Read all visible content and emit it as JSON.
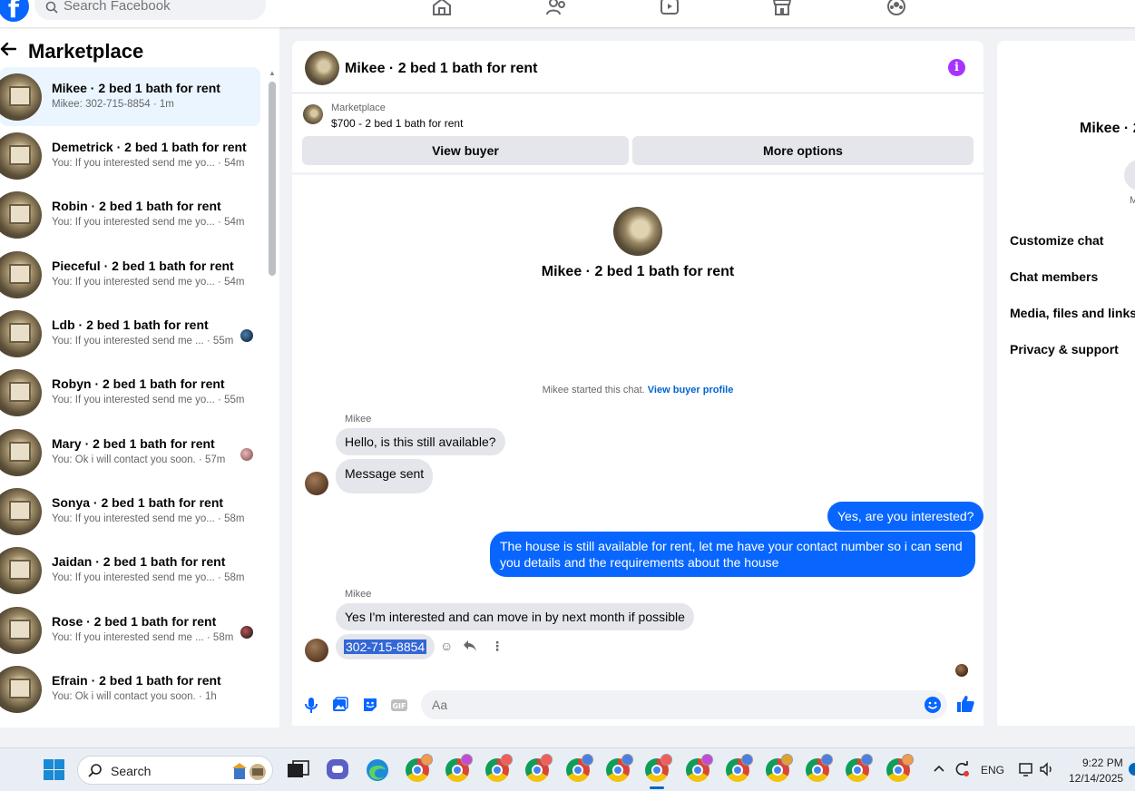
{
  "topbar": {
    "logo_letter": "f",
    "search_placeholder": "Search Facebook",
    "nav_icons": [
      "home-icon",
      "friends-icon",
      "video-icon",
      "marketplace-store-icon",
      "groups-icon"
    ]
  },
  "sidebar": {
    "title": "Marketplace",
    "conversations": [
      {
        "name": "Mikee · 2 bed 1 bath for rent",
        "preview": "Mikee: 302-715-8854 · 1m",
        "active": true
      },
      {
        "name": "Demetrick · 2 bed 1 bath for rent",
        "preview": "You: If you interested send me yo... · 54m"
      },
      {
        "name": "Robin · 2 bed 1 bath for rent",
        "preview": "You: If you interested send me yo... · 54m"
      },
      {
        "name": "Pieceful · 2 bed 1 bath for rent",
        "preview": "You: If you interested send me yo... · 54m"
      },
      {
        "name": "Ldb · 2 bed 1 bath for rent",
        "preview": "You: If you interested send me ... · 55m"
      },
      {
        "name": "Robyn · 2 bed 1 bath for rent",
        "preview": "You: If you interested send me yo... · 55m"
      },
      {
        "name": "Mary · 2 bed 1 bath for rent",
        "preview": "You: Ok i will contact you soon. · 57m"
      },
      {
        "name": "Sonya · 2 bed 1 bath for rent",
        "preview": "You: If you interested send me yo... · 58m"
      },
      {
        "name": "Jaidan · 2 bed 1 bath for rent",
        "preview": "You: If you interested send me yo... · 58m"
      },
      {
        "name": "Rose · 2 bed 1 bath for rent",
        "preview": "You: If you interested send me ... · 58m"
      },
      {
        "name": "Efrain · 2 bed 1 bath for rent",
        "preview": "You: Ok i will contact you soon. · 1h"
      }
    ]
  },
  "chat": {
    "title": "Mikee · 2 bed 1 bath for rent",
    "listing": {
      "source": "Marketplace",
      "price_title": "$700 - 2 bed 1 bath for rent",
      "view_buyer": "View buyer",
      "more_options": "More options"
    },
    "center_title": "Mikee · 2 bed 1 bath for rent",
    "started_text": "Mikee started this chat.",
    "view_buyer_profile": "View buyer profile",
    "sender_name": "Mikee",
    "messages": {
      "in1": "Hello, is this still available?",
      "in2": "Message sent",
      "out1": "Yes, are you interested?",
      "out2": "The house is still available for rent, let me have your contact number so i can send you details and the requirements about the house",
      "in3": "Yes I'm interested and can move in by next month if possible",
      "in4": "302-715-8854"
    },
    "composer_placeholder": "Aa"
  },
  "rightpanel": {
    "title": "Mikee · 2",
    "sub": "M",
    "items": [
      "Customize chat",
      "Chat members",
      "Media, files and links",
      "Privacy & support"
    ]
  },
  "taskbar": {
    "search_label": "Search",
    "language": "ENG",
    "time": "9:22 PM",
    "date": "12/14/2025"
  },
  "colors": {
    "accent": "#0866ff",
    "info": "#a633ff",
    "link": "#0064d1"
  }
}
